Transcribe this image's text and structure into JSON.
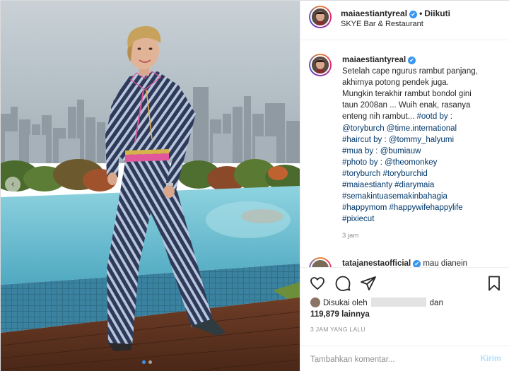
{
  "post": {
    "username": "maiaestiantyreal",
    "verified_mark": "✔",
    "separator": "•",
    "follow_status": "Diikuti",
    "location": "SKYE Bar & Restaurant"
  },
  "caption": {
    "username": "maiaestiantyreal",
    "text_lines": [
      "Setelah cape ngurus rambut panjang,",
      "akhirnya potong pendek juga.",
      "Mungkin terakhir rambut bondol gini",
      "taun 2008an ... Wuih enak, rasanya",
      "enteng nih rambut... "
    ],
    "ootd_tag": "#ootd by :",
    "tag_lines": [
      "@toryburch @time.international",
      "#haircut by : @tommy_halyumi",
      "#mua by : @bumiauw",
      "#photo by : @theomonkey",
      "#toryburch #toryburchid",
      "#maiaestianty #diarymaia",
      "#semakintuasemakinbahagia",
      "#happymom #happywifehappylife",
      "#pixiecut"
    ],
    "time": "3 jam"
  },
  "second_comment": {
    "username": "tatajanestaofficial",
    "text": "mau dianein"
  },
  "likes": {
    "prefix": "Disukai oleh",
    "conjunction": "dan",
    "count": "119,879",
    "suffix": "lainnya"
  },
  "posted_ago": "3 JAM YANG LALU",
  "comment_box": {
    "placeholder": "Tambahkan komentar...",
    "post_label": "Kirim"
  },
  "carousel": {
    "prev_glyph": "‹",
    "total": 2,
    "current": 1
  },
  "icons": [
    "heart-icon",
    "comment-icon",
    "share-icon",
    "bookmark-icon"
  ],
  "colors": {
    "link": "#00376b",
    "verified": "#3897f0",
    "muted": "#8e8e8e",
    "post_disabled": "#b2dffc"
  }
}
